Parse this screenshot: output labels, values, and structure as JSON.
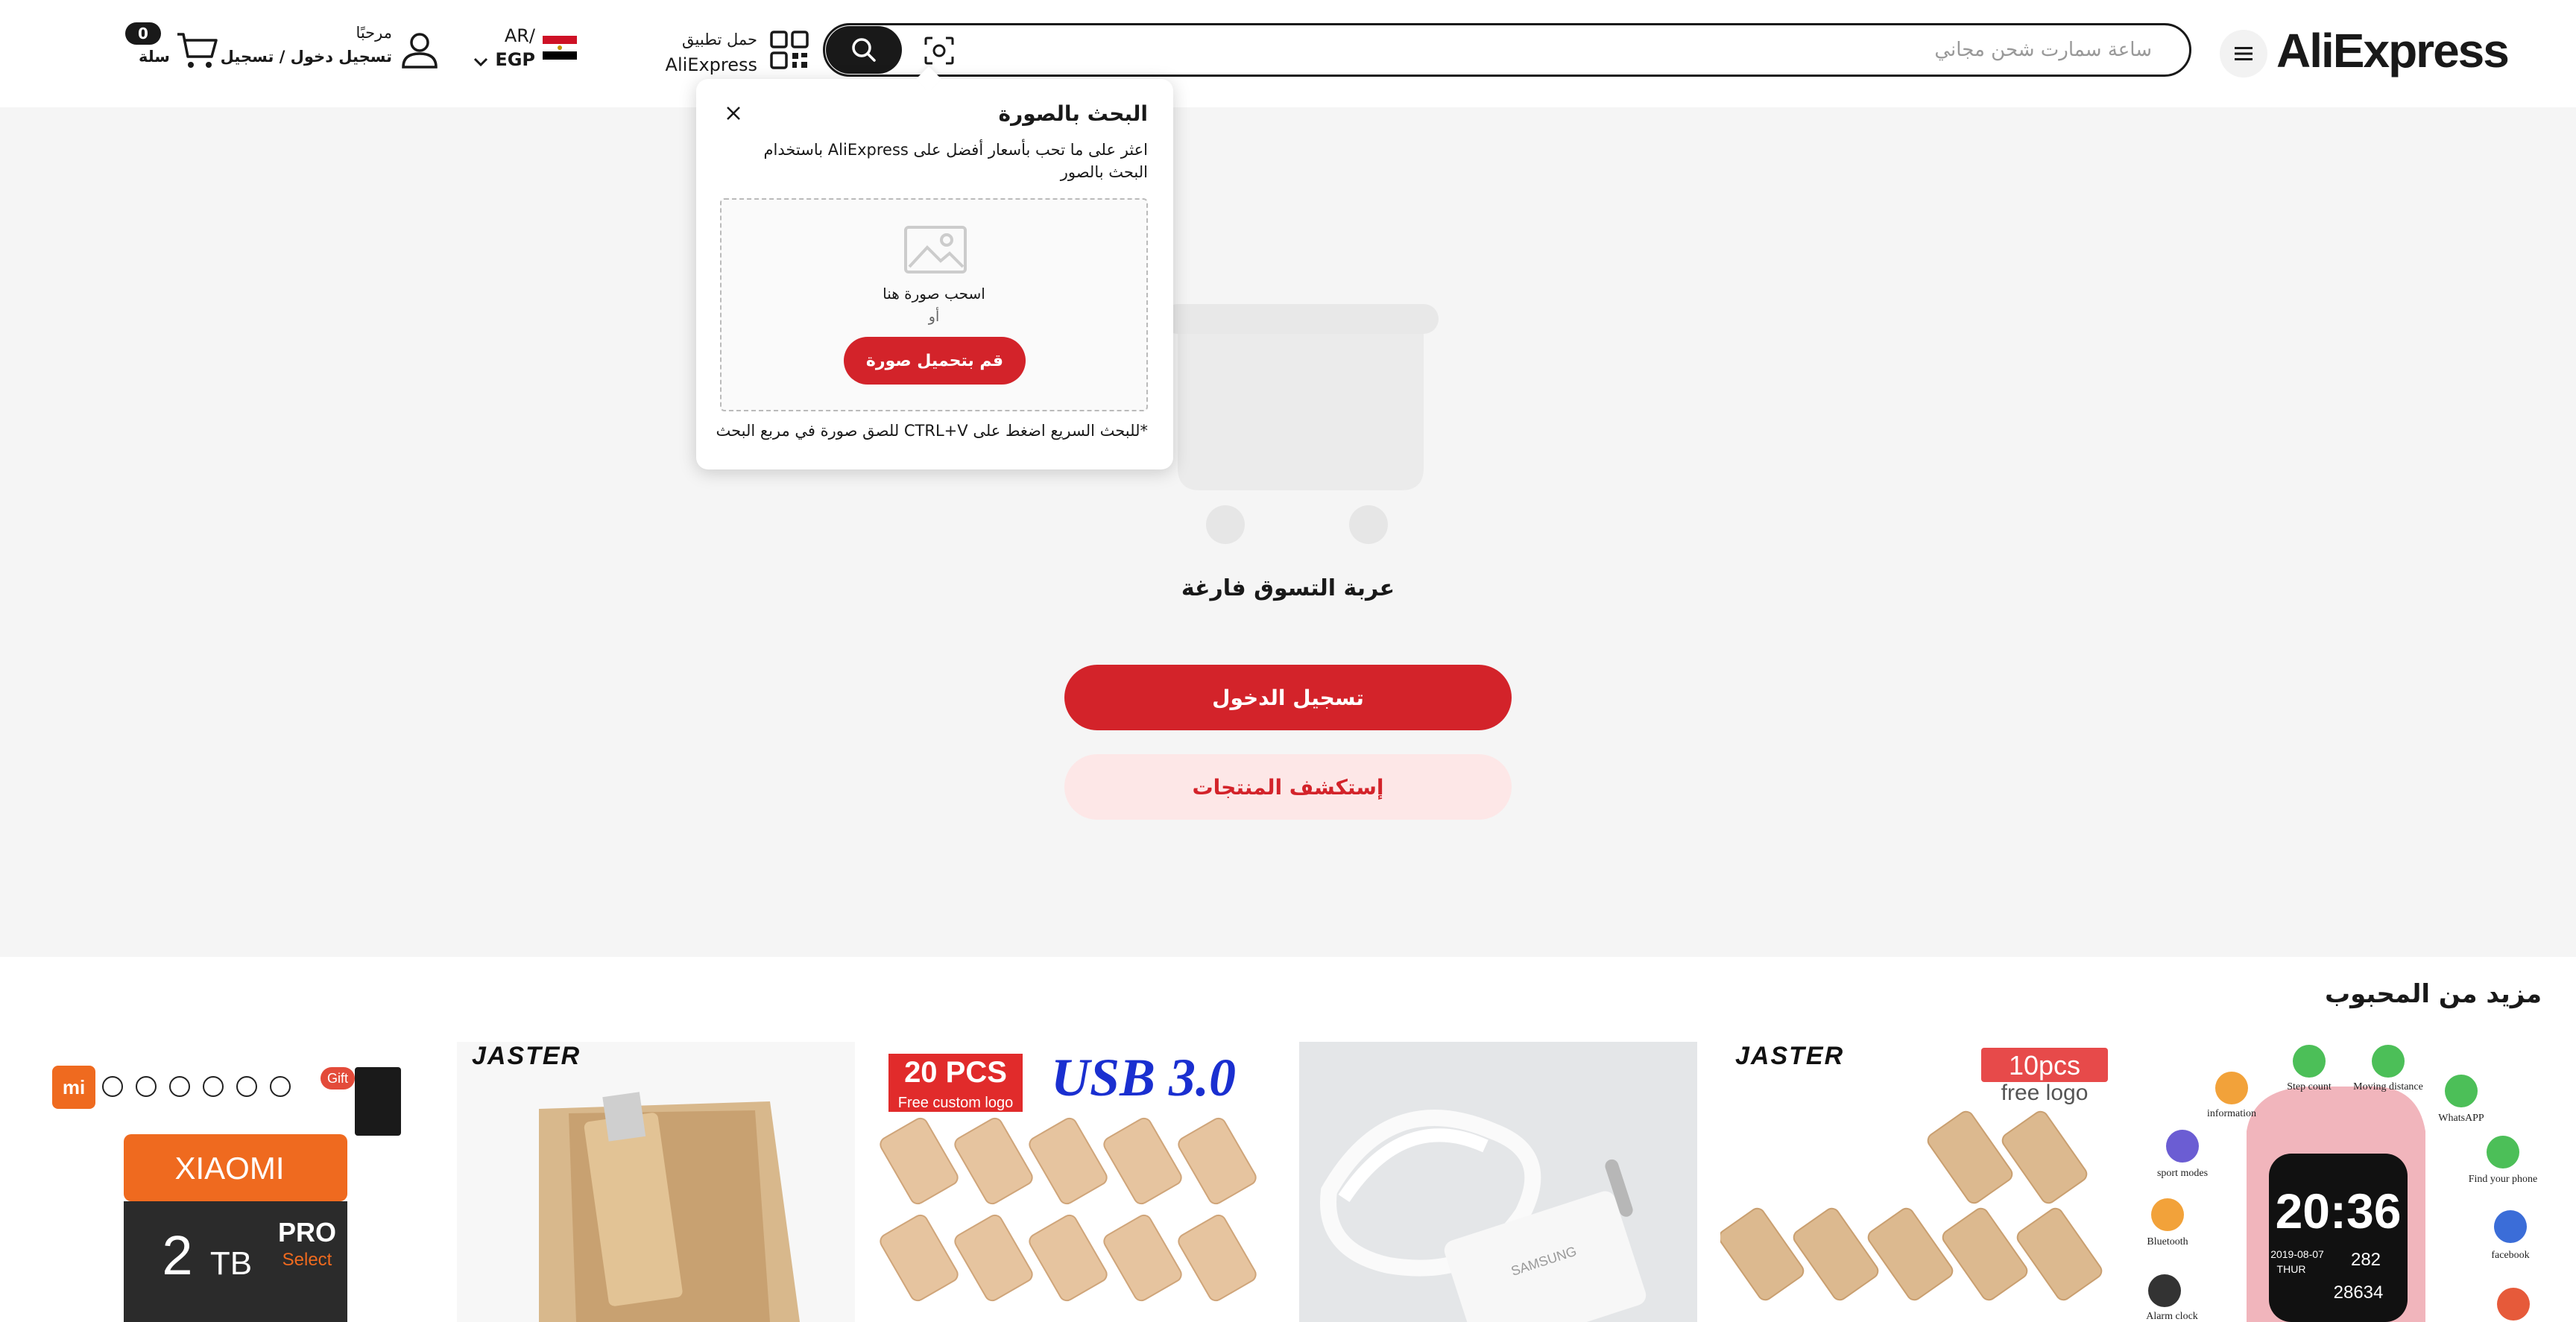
{
  "header": {
    "logo_text": "AliExpress",
    "menu_icon": "hamburger-menu-icon",
    "search": {
      "placeholder": "ساعة سمارت شحن مجاني",
      "value": ""
    },
    "app_download": {
      "line1": "حمل تطبيق",
      "line2": "AliExpress"
    },
    "language": {
      "line1": "AR/",
      "line2": "EGP"
    },
    "account": {
      "greeting": "مرحبًا",
      "action": "تسجيل دخول / تسجيل"
    },
    "cart": {
      "count": "0",
      "label": "سلة"
    }
  },
  "image_search_popup": {
    "title": "البحث بالصورة",
    "description": "اعثر على ما تحب بأسعار أفضل على AliExpress باستخدام البحث بالصور",
    "drag_text": "اسحب صورة هنا",
    "or_text": "أو",
    "upload_button": "قم بتحميل صورة",
    "hint": "*للبحث السريع اضغط على CTRL+V للصق صورة في مربع البحث"
  },
  "empty_cart": {
    "title": "عربة التسوق فارغة",
    "login_button": "تسجيل الدخول",
    "explore_button": "إستكشف المنتجات"
  },
  "more_to_love": {
    "title": "مزيد من المحبوب",
    "products": [
      {
        "brand_label": "XIAOMI",
        "capacity_value": "2",
        "capacity_unit": "TB",
        "tier": "PRO",
        "tier2": "Select",
        "gift_label": "Gift",
        "mi_label": "mi"
      },
      {
        "brand_label": "JASTER"
      },
      {
        "headline_left": "20 PCS",
        "headline_sub": "Free custom logo",
        "headline_right": "USB 3.0"
      },
      {
        "brand_label": "SAMSUNG"
      },
      {
        "brand_label": "JASTER",
        "badge_line1": "10pcs",
        "badge_line2": "free logo"
      },
      {
        "time": "20:36",
        "date": "2019-08-07",
        "day": "THUR",
        "steps": "28634",
        "hr": "282",
        "feature_labels": [
          "Step count",
          "Moving distance",
          "information",
          "WhatsAPP",
          "sport modes",
          "Find your phone",
          "Bluetooth",
          "facebook",
          "Alarm clock"
        ]
      }
    ]
  },
  "colors": {
    "brand_red": "#d3232a",
    "light_red": "#fde7e7",
    "text": "#191919",
    "section_bg": "#f5f5f5"
  }
}
